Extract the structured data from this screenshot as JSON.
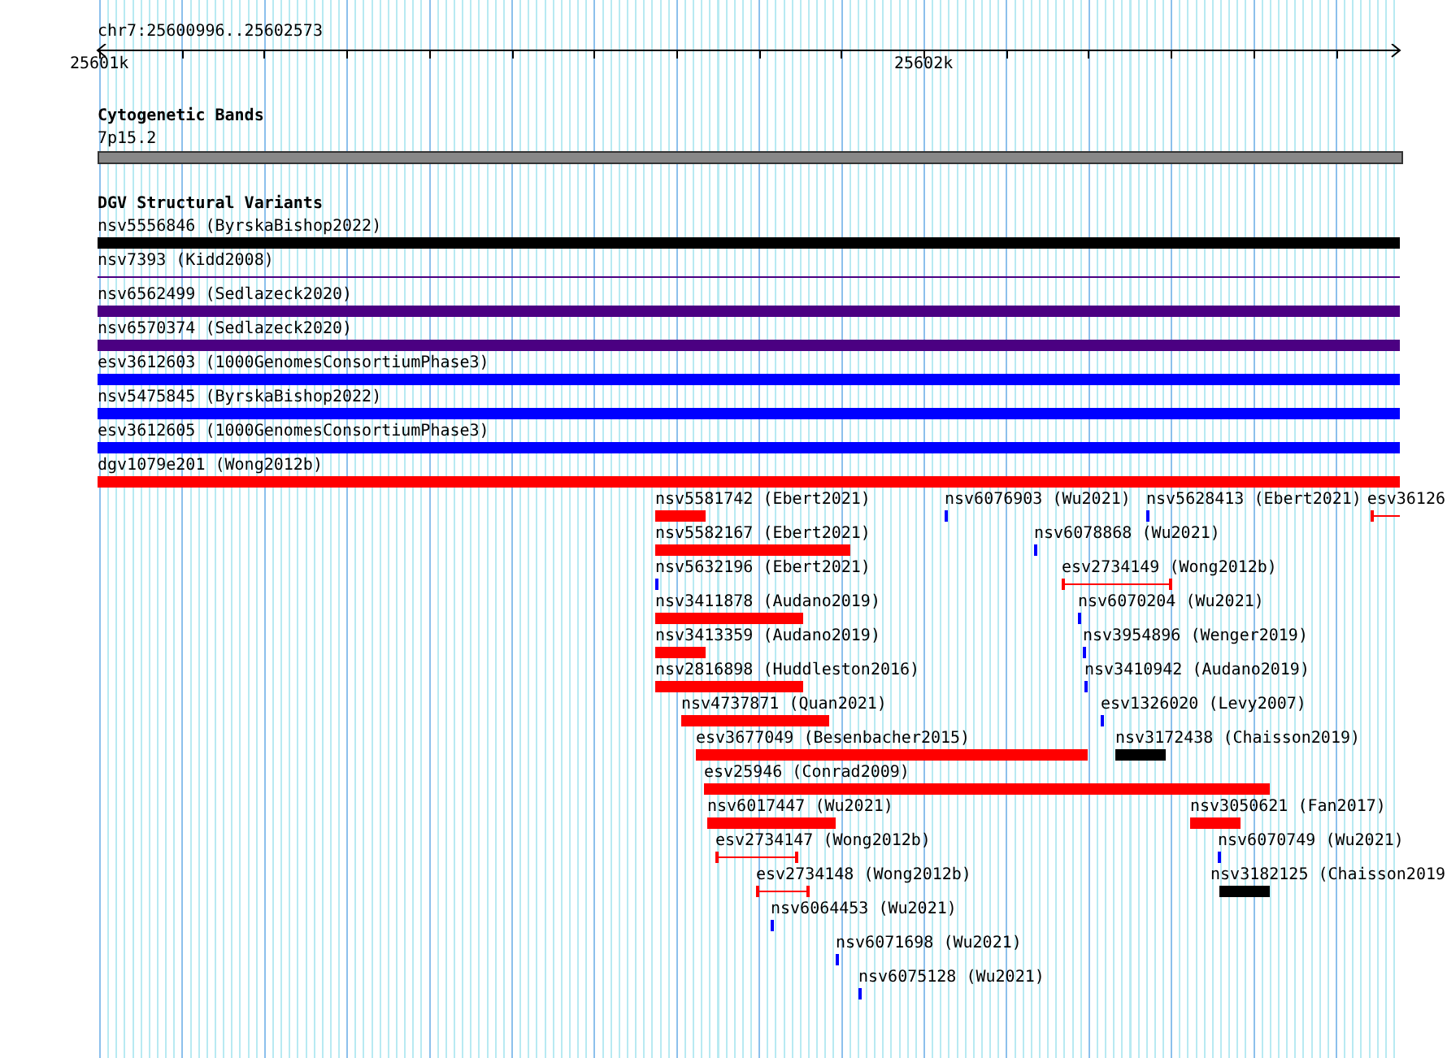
{
  "ruler": {
    "position": "chr7:25600996..25602573",
    "tick_labels": [
      "25601k",
      "25602k"
    ]
  },
  "tracks": [
    {
      "title": "Cytogenetic Bands",
      "features": [
        {
          "label": "7p15.2",
          "kind": "band",
          "color": "#888888"
        }
      ]
    },
    {
      "title": "DGV Structural Variants",
      "features": [
        {
          "label": "nsv5556846 (ByrskaBishop2022)",
          "kind": "bar",
          "color": "#000000"
        },
        {
          "label": "nsv7393 (Kidd2008)",
          "kind": "line",
          "color": "#4b0082"
        },
        {
          "label": "nsv6562499 (Sedlazeck2020)",
          "kind": "bar",
          "color": "#4b0082"
        },
        {
          "label": "nsv6570374 (Sedlazeck2020)",
          "kind": "bar",
          "color": "#4b0082"
        },
        {
          "label": "esv3612603 (1000GenomesConsortiumPhase3)",
          "kind": "bar",
          "color": "#0000ff"
        },
        {
          "label": "nsv5475845 (ByrskaBishop2022)",
          "kind": "bar",
          "color": "#0000ff"
        },
        {
          "label": "esv3612605 (1000GenomesConsortiumPhase3)",
          "kind": "bar",
          "color": "#0000ff"
        },
        {
          "label": "dgv1079e201 (Wong2012b)",
          "kind": "bar",
          "color": "#ff0000"
        },
        {
          "label": "nsv5581742 (Ebert2021)",
          "kind": "bar",
          "color": "#ff0000"
        },
        {
          "label": "nsv6076903 (Wu2021)",
          "kind": "bar",
          "color": "#0000ff"
        },
        {
          "label": "nsv5628413 (Ebert2021)",
          "kind": "bar",
          "color": "#0000ff"
        },
        {
          "label": "esv36126",
          "kind": "interval",
          "color": "#ff0000"
        },
        {
          "label": "nsv5582167 (Ebert2021)",
          "kind": "bar",
          "color": "#ff0000"
        },
        {
          "label": "nsv6078868 (Wu2021)",
          "kind": "bar",
          "color": "#0000ff"
        },
        {
          "label": "nsv5632196 (Ebert2021)",
          "kind": "bar",
          "color": "#0000ff"
        },
        {
          "label": "esv2734149 (Wong2012b)",
          "kind": "interval",
          "color": "#ff0000"
        },
        {
          "label": "nsv3411878 (Audano2019)",
          "kind": "bar",
          "color": "#ff0000"
        },
        {
          "label": "nsv6070204 (Wu2021)",
          "kind": "bar",
          "color": "#0000ff"
        },
        {
          "label": "nsv3413359 (Audano2019)",
          "kind": "bar",
          "color": "#ff0000"
        },
        {
          "label": "nsv3954896 (Wenger2019)",
          "kind": "bar",
          "color": "#0000ff"
        },
        {
          "label": "nsv2816898 (Huddleston2016)",
          "kind": "bar",
          "color": "#ff0000"
        },
        {
          "label": "nsv3410942 (Audano2019)",
          "kind": "bar",
          "color": "#0000ff"
        },
        {
          "label": "nsv4737871 (Quan2021)",
          "kind": "bar",
          "color": "#ff0000"
        },
        {
          "label": "esv1326020 (Levy2007)",
          "kind": "bar",
          "color": "#0000ff"
        },
        {
          "label": "esv3677049 (Besenbacher2015)",
          "kind": "bar",
          "color": "#ff0000"
        },
        {
          "label": "nsv3172438 (Chaisson2019)",
          "kind": "bar",
          "color": "#000000"
        },
        {
          "label": "esv25946 (Conrad2009)",
          "kind": "bar",
          "color": "#ff0000"
        },
        {
          "label": "nsv6017447 (Wu2021)",
          "kind": "bar",
          "color": "#ff0000"
        },
        {
          "label": "nsv3050621 (Fan2017)",
          "kind": "bar",
          "color": "#ff0000"
        },
        {
          "label": "esv2734147 (Wong2012b)",
          "kind": "interval",
          "color": "#ff0000"
        },
        {
          "label": "nsv6070749 (Wu2021)",
          "kind": "bar",
          "color": "#0000ff"
        },
        {
          "label": "esv2734148 (Wong2012b)",
          "kind": "interval",
          "color": "#ff0000"
        },
        {
          "label": "nsv3182125 (Chaisson2019",
          "kind": "bar",
          "color": "#000000"
        },
        {
          "label": "nsv6064453 (Wu2021)",
          "kind": "bar",
          "color": "#0000ff"
        },
        {
          "label": "nsv6071698 (Wu2021)",
          "kind": "bar",
          "color": "#0000ff"
        },
        {
          "label": "nsv6075128 (Wu2021)",
          "kind": "bar",
          "color": "#0000ff"
        }
      ]
    }
  ]
}
